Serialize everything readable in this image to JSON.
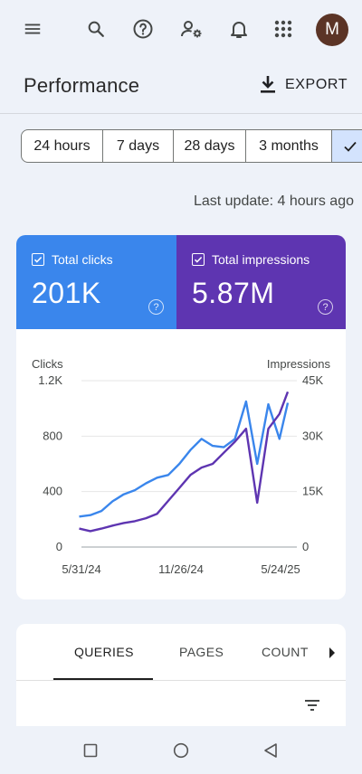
{
  "app_bar": {
    "avatar_initial": "M",
    "icons": [
      "menu-icon",
      "search-icon",
      "help-icon",
      "manage-accounts-icon",
      "notifications-icon",
      "apps-icon"
    ]
  },
  "page": {
    "title": "Performance",
    "export_label": "EXPORT"
  },
  "date_range": {
    "chips": [
      "24 hours",
      "7 days",
      "28 days",
      "3 months"
    ],
    "selected_icon": "check-icon"
  },
  "last_update": "Last update: 4 hours ago",
  "metrics": {
    "clicks": {
      "label": "Total clicks",
      "value": "201K",
      "color": "#3a86ec"
    },
    "impressions": {
      "label": "Total impressions",
      "value": "5.87M",
      "color": "#5e35b1"
    }
  },
  "chart_data": {
    "type": "line",
    "left_axis_title": "Clicks",
    "right_axis_title": "Impressions",
    "left_ticks": [
      "1.2K",
      "800",
      "400",
      "0"
    ],
    "left_tick_values": [
      1200,
      800,
      400,
      0
    ],
    "right_ticks": [
      "45K",
      "30K",
      "15K",
      "0"
    ],
    "right_tick_values": [
      45000,
      30000,
      15000,
      0
    ],
    "x_ticks": [
      "5/31/24",
      "11/26/24",
      "5/24/25"
    ],
    "x_tick_dates": [
      "2024-05-31",
      "2024-11-26",
      "2025-05-24"
    ],
    "ylim_left": [
      0,
      1200
    ],
    "ylim_right": [
      0,
      45000
    ],
    "grid": true,
    "series": [
      {
        "name": "Total clicks",
        "axis": "left",
        "color": "#3a86ec",
        "x": [
          "2024-05-27",
          "2024-06-16",
          "2024-07-06",
          "2024-07-26",
          "2024-08-15",
          "2024-09-04",
          "2024-09-24",
          "2024-10-14",
          "2024-11-03",
          "2024-11-23",
          "2024-12-13",
          "2025-01-02",
          "2025-01-22",
          "2025-02-11",
          "2025-03-03",
          "2025-03-23",
          "2025-04-12",
          "2025-05-02",
          "2025-05-22",
          "2025-06-06"
        ],
        "values": [
          220,
          230,
          260,
          330,
          380,
          410,
          460,
          500,
          520,
          600,
          700,
          780,
          730,
          720,
          780,
          1050,
          600,
          1030,
          780,
          1040
        ]
      },
      {
        "name": "Total impressions",
        "axis": "right",
        "color": "#5e35b1",
        "x": [
          "2024-05-27",
          "2024-06-16",
          "2024-07-06",
          "2024-07-26",
          "2024-08-15",
          "2024-09-04",
          "2024-09-24",
          "2024-10-14",
          "2024-11-03",
          "2024-11-23",
          "2024-12-13",
          "2025-01-02",
          "2025-01-22",
          "2025-02-11",
          "2025-03-03",
          "2025-03-23",
          "2025-04-12",
          "2025-05-02",
          "2025-05-22",
          "2025-06-06"
        ],
        "values": [
          5000,
          4300,
          5000,
          5800,
          6500,
          7000,
          7800,
          9000,
          12500,
          16000,
          19500,
          21500,
          22500,
          25500,
          28500,
          32000,
          12000,
          32000,
          36000,
          42000
        ]
      }
    ]
  },
  "tabs": {
    "items": [
      "QUERIES",
      "PAGES",
      "COUNT"
    ],
    "active_index": 0
  }
}
